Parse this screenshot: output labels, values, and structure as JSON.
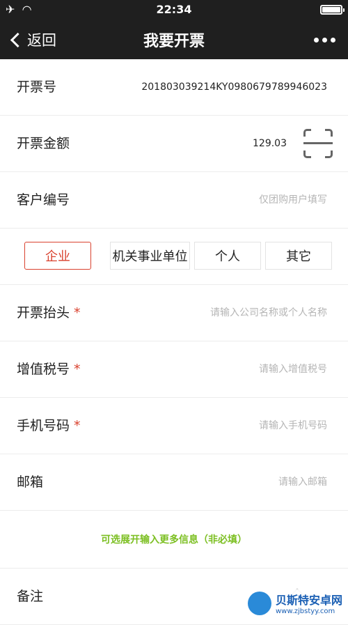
{
  "status": {
    "time": "22:34"
  },
  "nav": {
    "back": "返回",
    "title": "我要开票"
  },
  "form": {
    "invoice_no": {
      "label": "开票号",
      "value": "201803039214KY0980679789946023"
    },
    "amount": {
      "label": "开票金额",
      "value": "129.03"
    },
    "customer": {
      "label": "客户编号",
      "placeholder": "仅团购用户填写"
    },
    "types": [
      "企业",
      "机关事业单位",
      "个人",
      "其它"
    ],
    "title": {
      "label": "开票抬头",
      "required_mark": "*",
      "placeholder": "请输入公司名称或个人名称"
    },
    "tax": {
      "label": "增值税号",
      "required_mark": "*",
      "placeholder": "请输入增值税号"
    },
    "phone": {
      "label": "手机号码",
      "required_mark": "*",
      "placeholder": "请输入手机号码"
    },
    "email": {
      "label": "邮箱",
      "placeholder": "请输入邮箱"
    },
    "expand": "可选展开输入更多信息（非必填）",
    "remark": {
      "label": "备注"
    }
  },
  "watermark": {
    "line1": "贝斯特安卓网",
    "line2": "www.zjbstyy.com"
  },
  "colors": {
    "accent": "#d9412e",
    "green": "#7cbf22",
    "dark_bar": "#1f1f1f"
  },
  "icons": [
    "airplane-icon",
    "wifi-icon",
    "battery-icon",
    "chevron-left-icon",
    "more-icon",
    "scan-icon",
    "chevron-up-icon"
  ]
}
